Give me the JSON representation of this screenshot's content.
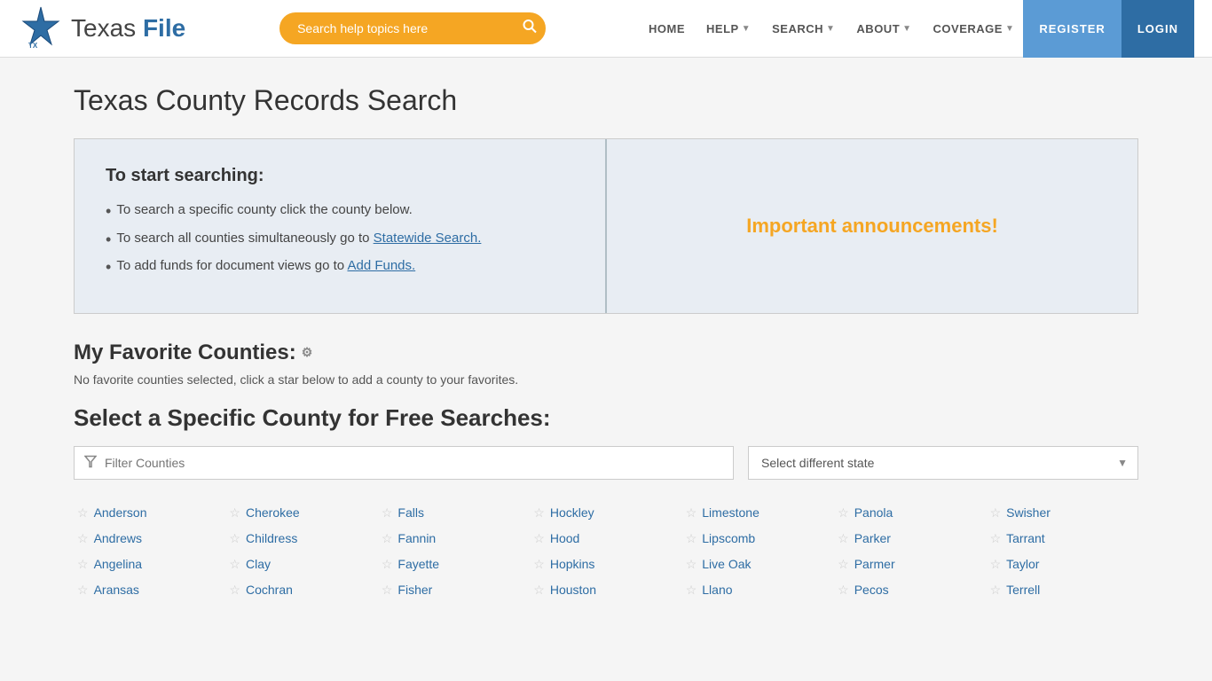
{
  "header": {
    "logo_text_plain": "Texas ",
    "logo_text_bold": "File",
    "search_placeholder": "Search help topics here",
    "nav": [
      {
        "label": "HOME",
        "has_dropdown": false,
        "id": "home"
      },
      {
        "label": "HELP",
        "has_dropdown": true,
        "id": "help"
      },
      {
        "label": "SEARCH",
        "has_dropdown": true,
        "id": "search"
      },
      {
        "label": "ABOUT",
        "has_dropdown": true,
        "id": "about"
      },
      {
        "label": "COVERAGE",
        "has_dropdown": true,
        "id": "coverage"
      }
    ],
    "register_label": "REGISTER",
    "login_label": "LOGIN"
  },
  "page": {
    "title": "Texas County Records Search"
  },
  "info_panel_left": {
    "heading": "To start searching:",
    "items": [
      {
        "text_plain": "To search a specific county click the county below."
      },
      {
        "text_plain": "To search all counties simultaneously go to ",
        "link_text": "Statewide Search.",
        "link_href": "#"
      },
      {
        "text_plain": "To add funds for document views go to ",
        "link_text": "Add Funds.",
        "link_href": "#"
      }
    ]
  },
  "info_panel_right": {
    "title": "Important announcements!"
  },
  "favorites": {
    "title": "My Favorite Counties:",
    "desc": "No favorite counties selected, click a star below to add a county to your favorites."
  },
  "county_search": {
    "title": "Select a Specific County for Free Searches:",
    "filter_placeholder": "Filter Counties",
    "state_placeholder": "Select different state",
    "counties": [
      "Anderson",
      "Andrews",
      "Angelina",
      "Aransas",
      "Cherokee",
      "Childress",
      "Clay",
      "Cochran",
      "Falls",
      "Fannin",
      "Fayette",
      "Fisher",
      "Hockley",
      "Hood",
      "Hopkins",
      "Houston",
      "Limestone",
      "Lipscomb",
      "Live Oak",
      "Llano",
      "Panola",
      "Parker",
      "Parmer",
      "Pecos",
      "Swisher",
      "Tarrant",
      "Taylor",
      "Terrell"
    ]
  }
}
